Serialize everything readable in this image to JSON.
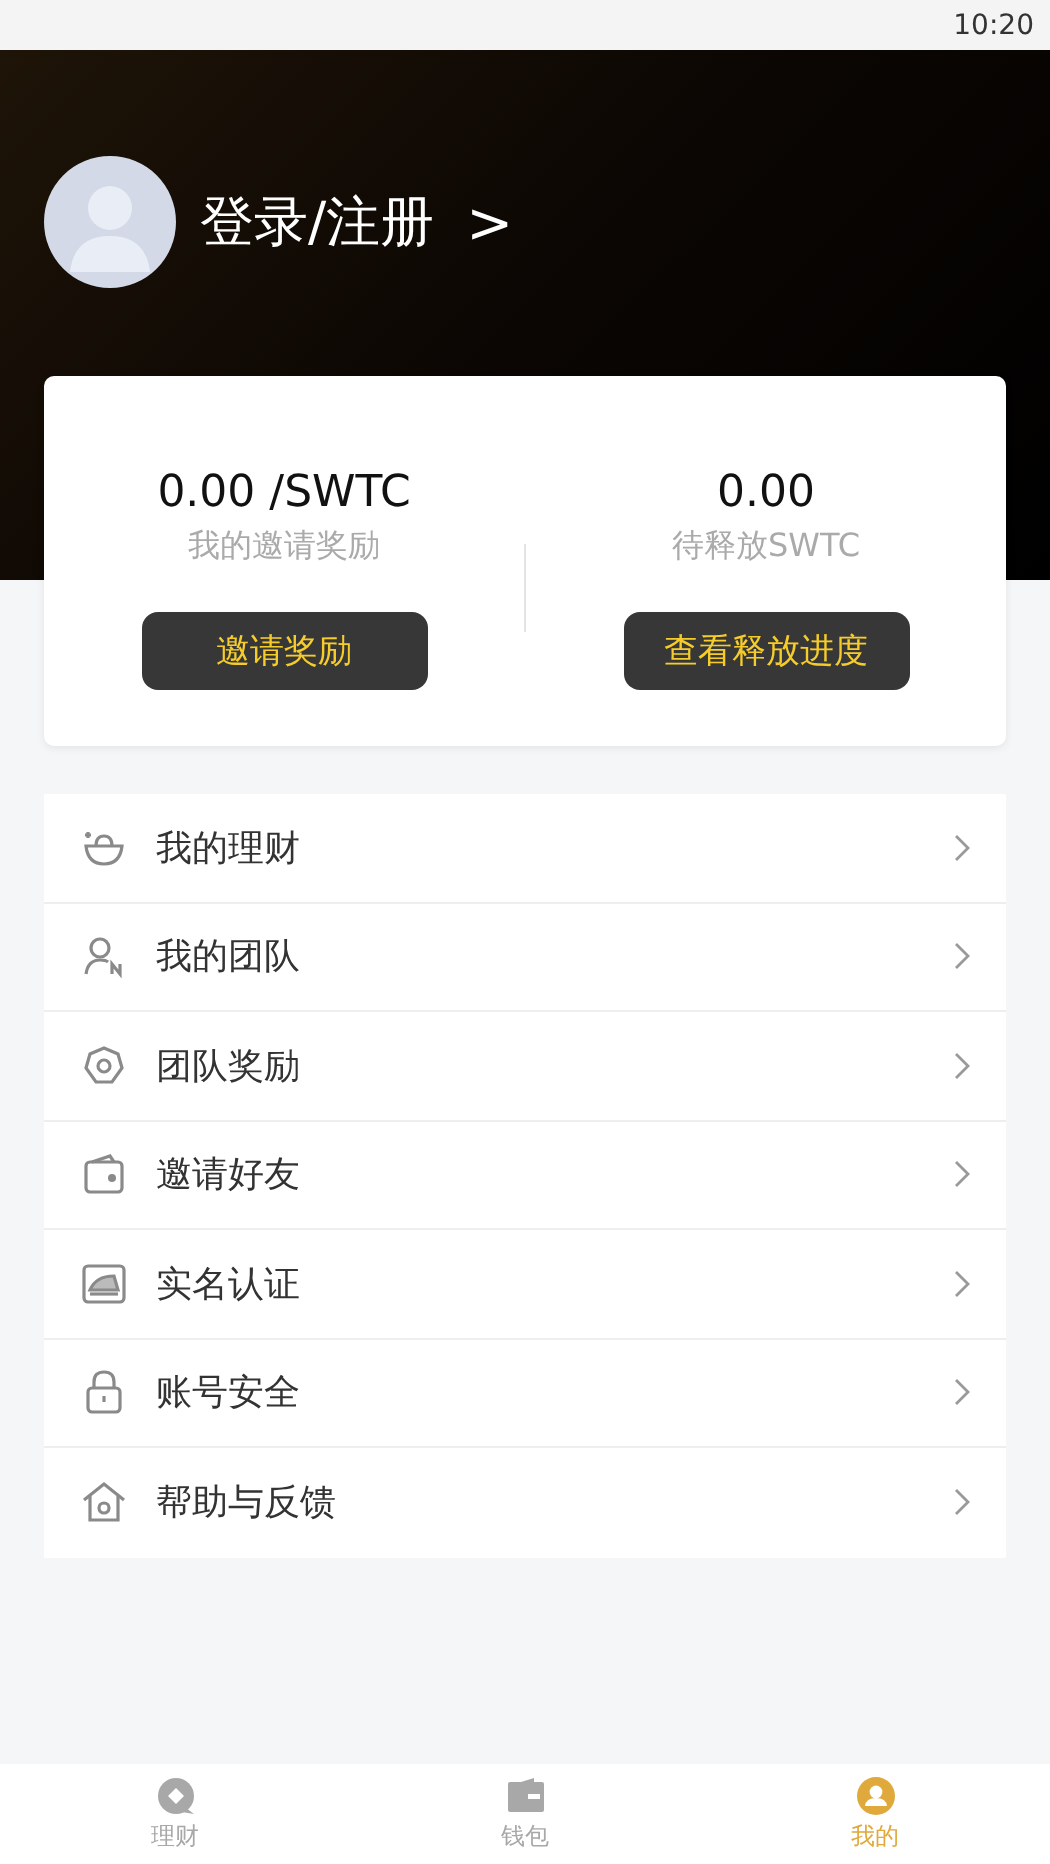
{
  "status_bar": {
    "time": "10:20"
  },
  "profile": {
    "login_label": "登录/注册",
    "chevron": ">"
  },
  "stats": [
    {
      "value": "0.00 /SWTC",
      "label": "我的邀请奖励",
      "button": "邀请奖励"
    },
    {
      "value": "0.00",
      "label": "待释放SWTC",
      "button": "查看释放进度"
    }
  ],
  "menu": [
    {
      "label": "我的理财"
    },
    {
      "label": "我的团队"
    },
    {
      "label": "团队奖励"
    },
    {
      "label": "邀请好友"
    },
    {
      "label": "实名认证"
    },
    {
      "label": "账号安全"
    },
    {
      "label": "帮助与反馈"
    }
  ],
  "tabs": [
    {
      "label": "理财",
      "selected": false
    },
    {
      "label": "钱包",
      "selected": false
    },
    {
      "label": "我的",
      "selected": true
    }
  ]
}
